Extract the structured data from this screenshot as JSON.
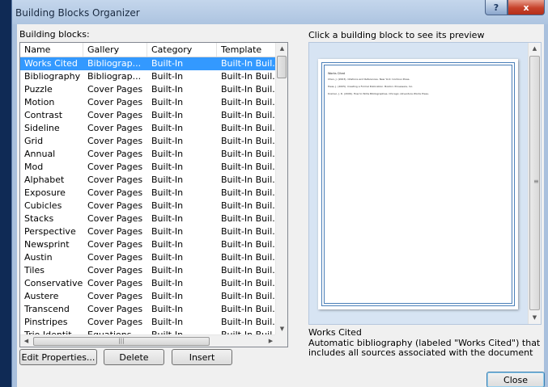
{
  "window": {
    "title": "Building Blocks Organizer",
    "help_label": "?",
    "close_label": "x"
  },
  "list": {
    "label": "Building blocks:",
    "columns": [
      "Name",
      "Gallery",
      "Category",
      "Template"
    ],
    "rows": [
      {
        "name": "Works Cited",
        "gallery": "Bibliograp...",
        "category": "Built-In",
        "template": "Built-In Buil..."
      },
      {
        "name": "Bibliography",
        "gallery": "Bibliograp...",
        "category": "Built-In",
        "template": "Built-In Buil..."
      },
      {
        "name": "Puzzle",
        "gallery": "Cover Pages",
        "category": "Built-In",
        "template": "Built-In Buil..."
      },
      {
        "name": "Motion",
        "gallery": "Cover Pages",
        "category": "Built-In",
        "template": "Built-In Buil..."
      },
      {
        "name": "Contrast",
        "gallery": "Cover Pages",
        "category": "Built-In",
        "template": "Built-In Buil..."
      },
      {
        "name": "Sideline",
        "gallery": "Cover Pages",
        "category": "Built-In",
        "template": "Built-In Buil..."
      },
      {
        "name": "Grid",
        "gallery": "Cover Pages",
        "category": "Built-In",
        "template": "Built-In Buil..."
      },
      {
        "name": "Annual",
        "gallery": "Cover Pages",
        "category": "Built-In",
        "template": "Built-In Buil..."
      },
      {
        "name": "Mod",
        "gallery": "Cover Pages",
        "category": "Built-In",
        "template": "Built-In Buil..."
      },
      {
        "name": "Alphabet",
        "gallery": "Cover Pages",
        "category": "Built-In",
        "template": "Built-In Buil..."
      },
      {
        "name": "Exposure",
        "gallery": "Cover Pages",
        "category": "Built-In",
        "template": "Built-In Buil..."
      },
      {
        "name": "Cubicles",
        "gallery": "Cover Pages",
        "category": "Built-In",
        "template": "Built-In Buil..."
      },
      {
        "name": "Stacks",
        "gallery": "Cover Pages",
        "category": "Built-In",
        "template": "Built-In Buil..."
      },
      {
        "name": "Perspective",
        "gallery": "Cover Pages",
        "category": "Built-In",
        "template": "Built-In Buil..."
      },
      {
        "name": "Newsprint",
        "gallery": "Cover Pages",
        "category": "Built-In",
        "template": "Built-In Buil..."
      },
      {
        "name": "Austin",
        "gallery": "Cover Pages",
        "category": "Built-In",
        "template": "Built-In Buil..."
      },
      {
        "name": "Tiles",
        "gallery": "Cover Pages",
        "category": "Built-In",
        "template": "Built-In Buil..."
      },
      {
        "name": "Conservative",
        "gallery": "Cover Pages",
        "category": "Built-In",
        "template": "Built-In Buil..."
      },
      {
        "name": "Austere",
        "gallery": "Cover Pages",
        "category": "Built-In",
        "template": "Built-In Buil..."
      },
      {
        "name": "Transcend",
        "gallery": "Cover Pages",
        "category": "Built-In",
        "template": "Built-In Buil..."
      },
      {
        "name": "Pinstripes",
        "gallery": "Cover Pages",
        "category": "Built-In",
        "template": "Built-In Buil..."
      },
      {
        "name": "Trio Identit...",
        "gallery": "Equations",
        "category": "Built-In",
        "template": "Built-In Buil..."
      }
    ],
    "selected_index": 0
  },
  "buttons": {
    "edit_properties": "Edit Properties...",
    "delete": "Delete",
    "insert": "Insert",
    "close": "Close"
  },
  "preview": {
    "label": "Click a building block to see its preview",
    "doc_title": "Works Cited",
    "doc_lines": [
      "Chen, J. (2003). Citations and References. New York: Contoso Press.",
      "Haas, J. (2005). Creating a Formal Publication. Boston: Proseware, Inc.",
      "Kramer, J. D. (2006). How to Write Bibliographies. Chicago: Adventure Works Press."
    ],
    "selected_name": "Works Cited",
    "description": "Automatic bibliography (labeled \"Works Cited\") that includes all sources associated with the document"
  },
  "colors": {
    "selection": "#3399ff",
    "frame": "#4a7fb8"
  }
}
